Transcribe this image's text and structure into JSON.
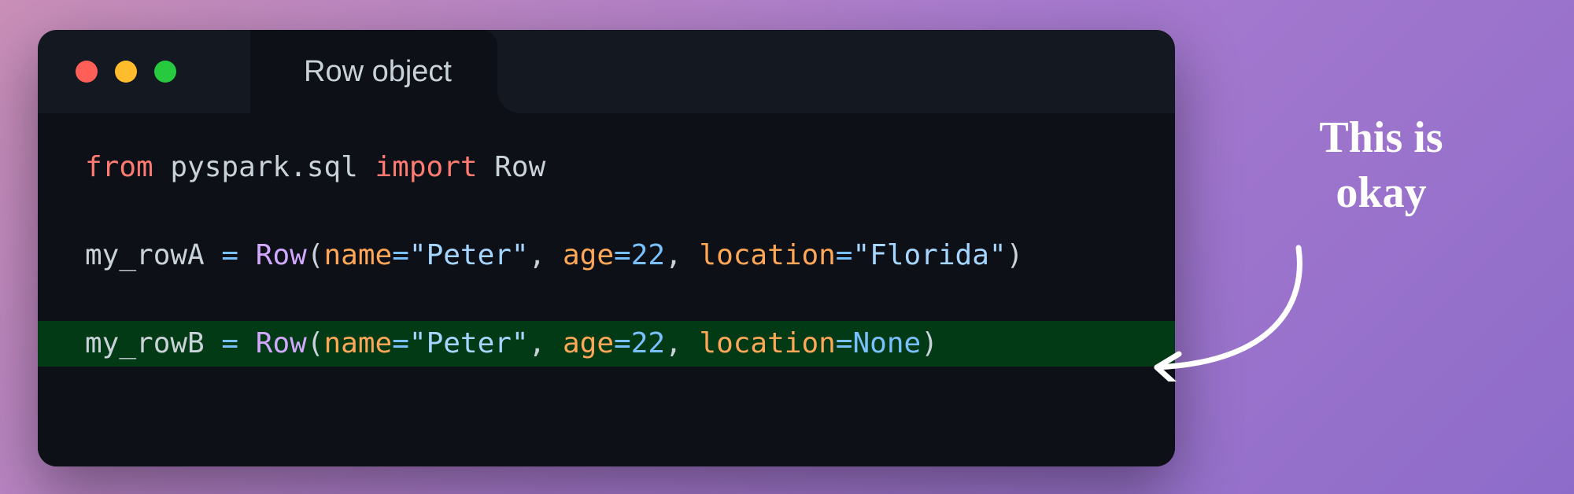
{
  "tab": {
    "title": "Row object"
  },
  "code": {
    "l1": {
      "from": "from",
      "mod": "pyspark.sql",
      "import": "import",
      "cls": "Row"
    },
    "l3": {
      "var": "my_rowA",
      "call": "Row",
      "p1": "name",
      "v1": "\"Peter\"",
      "p2": "age",
      "v2": "22",
      "p3": "location",
      "v3": "\"Florida\""
    },
    "l5": {
      "var": "my_rowB",
      "call": "Row",
      "p1": "name",
      "v1": "\"Peter\"",
      "p2": "age",
      "v2": "22",
      "p3": "location",
      "v3": "None"
    }
  },
  "annotation": {
    "line1": "This is",
    "line2": "okay"
  }
}
